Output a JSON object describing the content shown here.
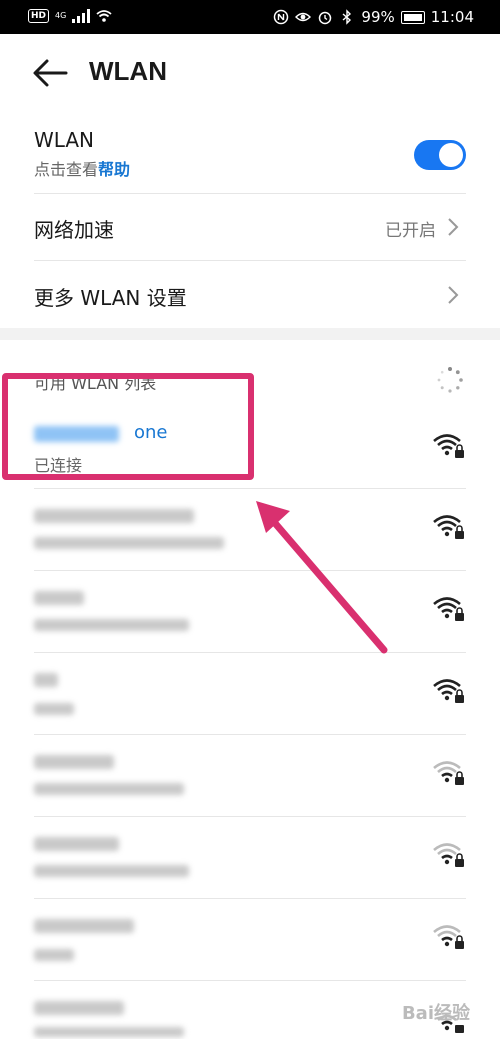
{
  "status_bar": {
    "hd": "HD",
    "network": "4G",
    "battery": "99%",
    "time": "11:04"
  },
  "header": {
    "title": "WLAN"
  },
  "settings": {
    "wlan_label": "WLAN",
    "wlan_sub_prefix": "点击查看",
    "wlan_sub_link": "帮助",
    "wlan_enabled": true,
    "accel_label": "网络加速",
    "accel_value": "已开启",
    "more_label": "更多 WLAN 设置"
  },
  "available": {
    "section_title": "可用 WLAN 列表",
    "connected": {
      "name_visible_suffix": "one",
      "status": "已连接"
    }
  },
  "colors": {
    "accent": "#1877f2",
    "highlight": "#d9306f"
  },
  "watermark": "Bai经验"
}
